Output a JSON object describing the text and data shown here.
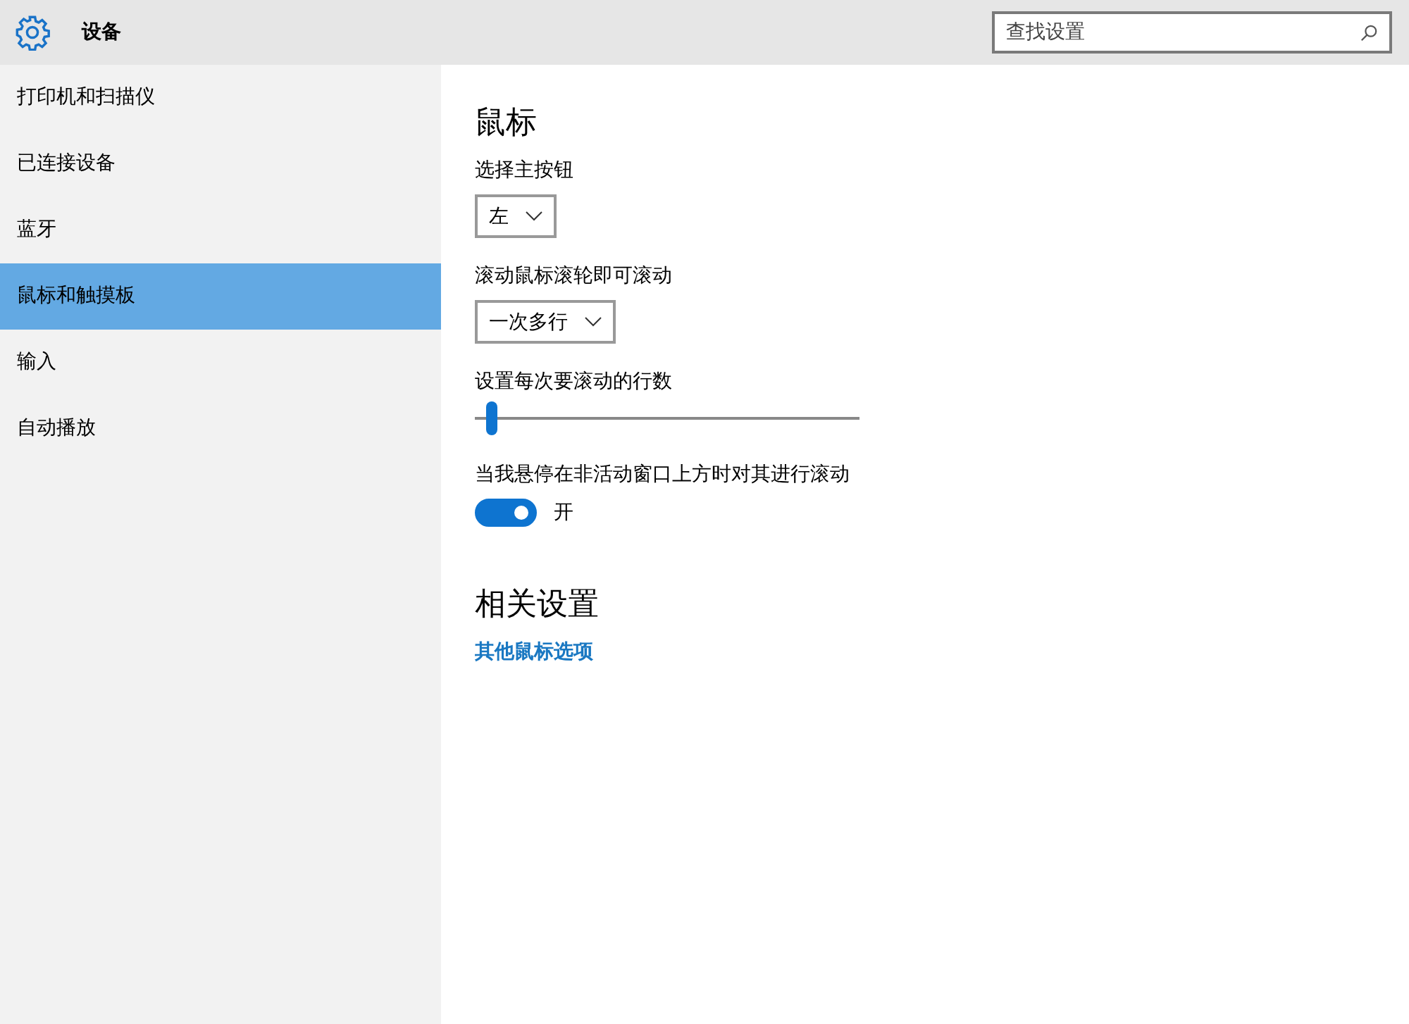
{
  "header": {
    "title": "设备",
    "search": {
      "placeholder": "查找设置"
    }
  },
  "sidebar": {
    "items": [
      {
        "label": "打印机和扫描仪",
        "selected": false
      },
      {
        "label": "已连接设备",
        "selected": false
      },
      {
        "label": "蓝牙",
        "selected": false
      },
      {
        "label": "鼠标和触摸板",
        "selected": true
      },
      {
        "label": "输入",
        "selected": false
      },
      {
        "label": "自动播放",
        "selected": false
      }
    ]
  },
  "content": {
    "title": "鼠标",
    "settings": [
      {
        "kind": "dropdown",
        "label": "选择主按钮",
        "value": "左"
      },
      {
        "kind": "dropdown",
        "label": "滚动鼠标滚轮即可滚动",
        "value": "一次多行"
      },
      {
        "kind": "slider",
        "label": "设置每次要滚动的行数",
        "level": 0.03
      },
      {
        "kind": "toggle",
        "label": "当我悬停在非活动窗口上方时对其进行滚动",
        "on": true,
        "state_text": "开"
      }
    ],
    "related": {
      "title": "相关设置",
      "links": [
        "其他鼠标选项"
      ]
    }
  }
}
